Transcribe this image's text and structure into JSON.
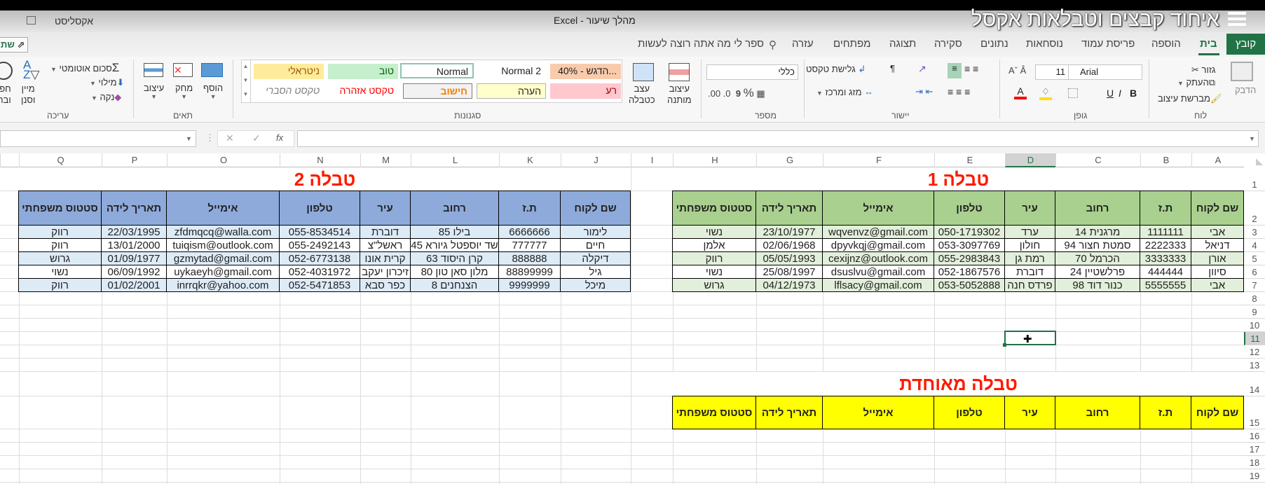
{
  "title_bar": {
    "overlay_title": "איחוד קבצים וטבלאות אקסל",
    "document_title": "מהלך שיעור  -  Excel",
    "user": "אקסליסט"
  },
  "tabs": [
    {
      "label": "קובץ",
      "active": false
    },
    {
      "label": "בית",
      "active": true
    },
    {
      "label": "הוספה"
    },
    {
      "label": "פריסת עמוד"
    },
    {
      "label": "נוסחאות"
    },
    {
      "label": "נתונים"
    },
    {
      "label": "סקירה"
    },
    {
      "label": "תצוגה"
    },
    {
      "label": "מפתחים"
    },
    {
      "label": "עזרה"
    }
  ],
  "search_placeholder": "ספר לי מה אתה רוצה לעשות",
  "share_label": "שת",
  "ribbon": {
    "clipboard": {
      "paste": "הדבק",
      "cut": "גזור",
      "copy": "העתק",
      "format_painter": "מברשת עיצוב",
      "label": "לוח"
    },
    "font": {
      "name": "Arial",
      "size": "11",
      "bold": "B",
      "italic": "I",
      "underline": "U",
      "label": "גופן"
    },
    "alignment": {
      "wrap_text": "גלישת טקסט",
      "merge_center": "מזג ומרכז",
      "label": "יישור"
    },
    "number": {
      "format": "כללי",
      "label": "מספר"
    },
    "styles": {
      "conditional_formatting": [
        "עיצוב",
        "מותנה"
      ],
      "format_as_table": [
        "עצב",
        "כטבלה"
      ],
      "gallery": [
        {
          "label": "...הדגש - 40%",
          "bg": "#f8cbad",
          "color": "#222"
        },
        {
          "label": "Normal 2",
          "bg": "transparent",
          "color": "#222"
        },
        {
          "label": "Normal",
          "bg": "#ffffff",
          "color": "#222"
        },
        {
          "label": "טוב",
          "bg": "#c6efce",
          "color": "#006100"
        },
        {
          "label": "ניטראלי",
          "bg": "#ffeb9c",
          "color": "#9c5700"
        },
        {
          "label": "רע",
          "bg": "#ffc7ce",
          "color": "#9c0006"
        },
        {
          "label": "הערה",
          "bg": "#ffffcc",
          "color": "#222"
        },
        {
          "label": "חישוב",
          "bg": "#f2f2f2",
          "color": "#fa7d00"
        },
        {
          "label": "טקסט אזהרה",
          "bg": "transparent",
          "color": "#ff0000"
        },
        {
          "label": "טקסט הסברי",
          "bg": "transparent",
          "color": "#7f7f7f"
        }
      ],
      "label": "סגנונות"
    },
    "cells": {
      "insert": "הוסף",
      "delete": "מחק",
      "format": "עיצוב",
      "label": "תאים"
    },
    "editing": {
      "autosum": "סכום אוטומטי",
      "fill": "מילוי",
      "clear": "נקה",
      "sort_filter": [
        "מיין",
        "וסנן"
      ],
      "find_select": [
        "חפ",
        "ובח"
      ],
      "label": "עריכה"
    }
  },
  "formula_bar": {
    "name_box": "",
    "fx": "fx",
    "value": ""
  },
  "sheet": {
    "columns": [
      "A",
      "B",
      "C",
      "D",
      "E",
      "F",
      "G",
      "H",
      "I",
      "J",
      "K",
      "L",
      "M",
      "N",
      "O",
      "P",
      "Q"
    ],
    "rows": [
      "1",
      "2",
      "3",
      "4",
      "5",
      "6",
      "7",
      "8",
      "9",
      "10",
      "11",
      "12",
      "13",
      "14",
      "15",
      "16",
      "17",
      "18",
      "19"
    ],
    "selected_cell": "D11",
    "table1": {
      "title": "טבלה 1",
      "header_color": "#a9d08e",
      "band_color": "#e2efda",
      "headers": [
        "שם לקוח",
        "ת.ז",
        "רחוב",
        "עיר",
        "טלפון",
        "אימייל",
        "תאריך לידה",
        "סטטוס משפחתי"
      ],
      "rows": [
        [
          "אבי",
          "1111111",
          "מרגנית 14",
          "ערד",
          "050-1719302",
          "wqvenvz@gmail.com",
          "23/10/1977",
          "נשוי"
        ],
        [
          "דניאל",
          "2222333",
          "סמטת חצור 94",
          "חולון",
          "053-3097769",
          "dpyvkqj@gmail.com",
          "02/06/1968",
          "אלמן"
        ],
        [
          "אורן",
          "3333333",
          "הכרמל 70",
          "רמת גן",
          "055-2983843",
          "cexijnz@outlook.com",
          "05/05/1993",
          "רווק"
        ],
        [
          "סיוון",
          "444444",
          "פרלשטיין 24",
          "דוברת",
          "052-1867576",
          "dsuslvu@gmail.com",
          "25/08/1997",
          "נשוי"
        ],
        [
          "אבי",
          "5555555",
          "כנור דוד 98",
          "פרדס חנה",
          "053-5052888",
          "lflsacy@gmail.com",
          "04/12/1973",
          "גרוש"
        ]
      ]
    },
    "table2": {
      "title": "טבלה 2",
      "header_color": "#8eaadb",
      "band_color": "#ddebf7",
      "headers": [
        "שם לקוח",
        "ת.ז",
        "רחוב",
        "עיר",
        "טלפון",
        "אימייל",
        "תאריך לידה",
        "סטטוס משפחתי"
      ],
      "rows": [
        [
          "לימור",
          "6666666",
          "בילו 85",
          "דוברת",
          "055-8534514",
          "zfdmqcq@walla.com",
          "22/03/1995",
          "רווק"
        ],
        [
          "חיים",
          "777777",
          "שד יוספטל גיורא 45",
          "ראשל\"צ",
          "055-2492143",
          "tuiqism@outlook.com",
          "13/01/2000",
          "רווק"
        ],
        [
          "דיקלה",
          "888888",
          "קרן היסוד 63",
          "קרית אונו",
          "052-6773138",
          "gzmytad@gmail.com",
          "01/09/1977",
          "גרוש"
        ],
        [
          "גיל",
          "88899999",
          "מלון סאן טון 80",
          "זיכרון יעקב",
          "052-4031972",
          "uykaeyh@gmail.com",
          "06/09/1992",
          "נשוי"
        ],
        [
          "מיכל",
          "9999999",
          "הצנחנים 8",
          "כפר סבא",
          "052-5471853",
          "inrrqkr@yahoo.com",
          "01/02/2001",
          "רווק"
        ]
      ]
    },
    "merged_table": {
      "title": "טבלה מאוחדת",
      "header_color": "#ffff00",
      "headers": [
        "שם לקוח",
        "ת.ז",
        "רחוב",
        "עיר",
        "טלפון",
        "אימייל",
        "תאריך לידה",
        "סטטוס משפחתי"
      ]
    }
  }
}
